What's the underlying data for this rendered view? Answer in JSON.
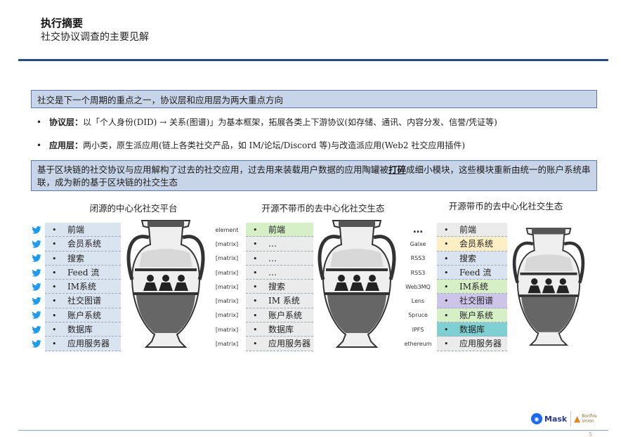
{
  "header": {
    "title": "执行摘要",
    "subtitle": "社交协议调查的主要见解"
  },
  "banner_top": "社交是下一个周期的重点之一，协议层和应用层为两大重点方向",
  "bullets": [
    {
      "label": "协议层：",
      "text": "以「个人身份(DID) → 关系(图谱)」为基本框架，拓展各类上下游协议(如存储、通讯、内容分发、信誉/凭证等)"
    },
    {
      "label": "应用层：",
      "text": "两小类，原生派应用(链上各类社交产品，如 IM/论坛/Discord 等)与改造派应用(Web2 社交应用插件)"
    }
  ],
  "banner_bottom": {
    "before": "基于区块链的社交协议与应用解构了过去的社交应用，过去用来装载用户数据的应用陶罐被",
    "emphasis": "打碎",
    "after": "成细小模块，这些模块重新由统一的账户系统串联，成为新的基于区块链的社交生态"
  },
  "columns": [
    {
      "title": "闭源的中心化社交平台",
      "rows": [
        "前端",
        "会员系统",
        "搜索",
        "Feed 流",
        "IM系统",
        "社交图谱",
        "账户系统",
        "数据库",
        "应用服务器"
      ]
    },
    {
      "title": "开源不带币的去中心化社交生态",
      "rows": [
        "前端",
        "…",
        "…",
        "…",
        "搜索",
        "IM 系统",
        "账户系统",
        "数据库",
        "应用服务器"
      ],
      "logos": [
        "element",
        "[matrix]",
        "[matrix]",
        "[matrix]",
        "[matrix]",
        "[matrix]",
        "[matrix]",
        "[matrix]",
        "[matrix]"
      ]
    },
    {
      "title": "开源带币的去中心化社交生态",
      "rows": [
        "前端",
        "会员系统",
        "搜索",
        "Feed 流",
        "IM系统",
        "社交图谱",
        "账户系统",
        "数据库",
        "应用服务器"
      ],
      "logos": [
        "…",
        "Galxe",
        "RSS3",
        "RSS3",
        "Web3MQ",
        "Lens",
        "Spruce",
        "IPFS",
        "ethereum"
      ]
    }
  ],
  "colors": {
    "accent": "#274b86",
    "banner_bg": "#c8d4e8",
    "row_blue": "#dae3f0",
    "row_green": "#d6efc7",
    "row_yellow": "#fdefc3",
    "row_purple": "#cdc4ea",
    "row_teal": "#7fd0d2",
    "row_gray": "#ebebeb"
  },
  "footer": {
    "page": "5",
    "mask": "Mask",
    "bonfire": "Bonfire Union"
  }
}
